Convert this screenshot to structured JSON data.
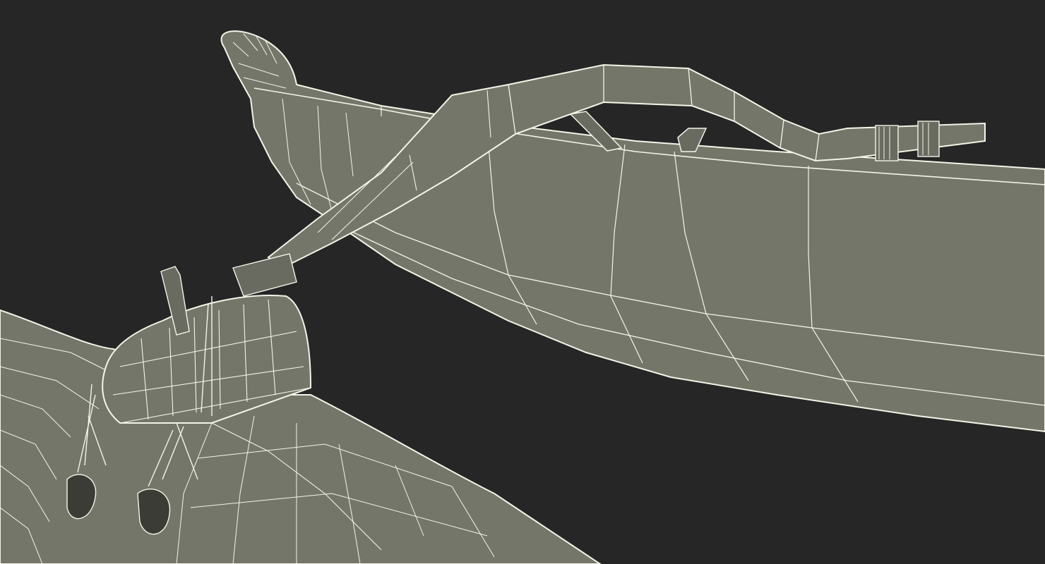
{
  "scene": {
    "background_color": "#262626",
    "surface_color": "#75766a",
    "surface_shadow_color": "#5f6056",
    "wire_color": "#f4f4e8"
  }
}
